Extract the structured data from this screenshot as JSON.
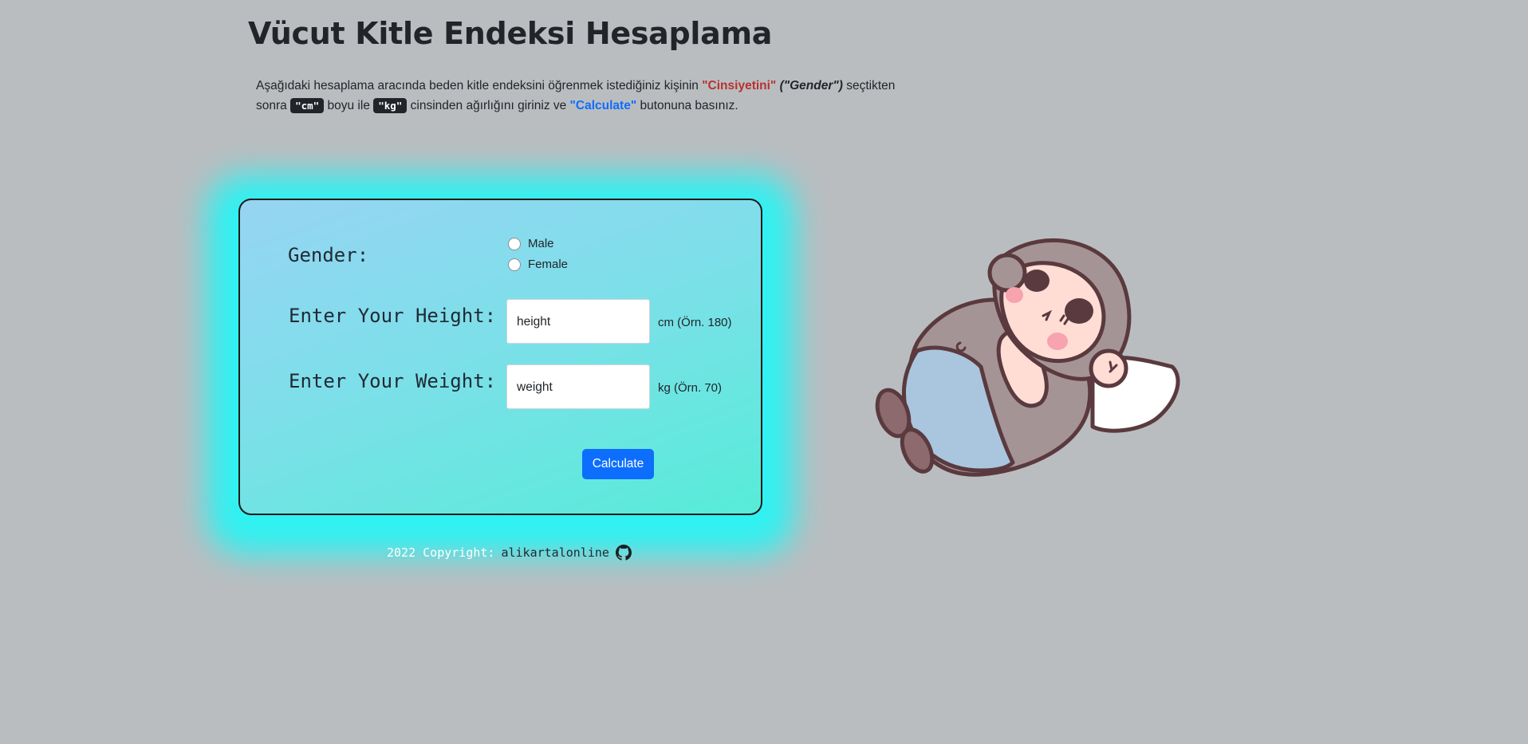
{
  "page": {
    "title": "Vücut Kitle Endeksi Hesaplama"
  },
  "intro": {
    "part1": "Aşağıdaki hesaplama aracında beden kitle endeksini öğrenmek istediğiniz kişinin ",
    "gender_tr": "\"Cinsiyetini\"",
    "gender_en": "(\"Gender\")",
    "part2": " seçtikten sonra ",
    "cm_code": "\"cm\"",
    "part3": " boyu ile ",
    "kg_code": "\"kg\"",
    "part4": " cinsinden ağırlığını giriniz ve ",
    "calculate_ref": "\"Calculate\"",
    "part5": " butonuna basınız."
  },
  "form": {
    "gender_label": "Gender:",
    "gender_options": [
      "Male",
      "Female"
    ],
    "height_label": "Enter Your Height:",
    "height_value": "height",
    "height_unit": "cm (Örn. 180)",
    "weight_label": "Enter Your Weight:",
    "weight_value": "weight",
    "weight_unit": "kg (Örn. 70)",
    "calculate_label": "Calculate"
  },
  "footer": {
    "copyright": "2022 Copyright:",
    "owner": "alikartalonline"
  },
  "icons": {
    "github": "github-icon",
    "illustration": "sleeping-character-illustration"
  },
  "colors": {
    "background": "#babdc0",
    "accent_blue": "#0d6efd",
    "accent_red": "#b8312f",
    "glow": "#2ff2f2"
  }
}
